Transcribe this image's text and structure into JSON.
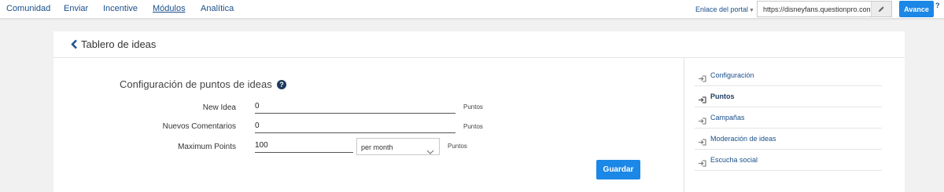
{
  "nav": {
    "items": [
      "Comunidad",
      "Enviar",
      "Incentive",
      "Módulos",
      "Analítica"
    ],
    "active_index": 3
  },
  "portal": {
    "label": "Enlace del portal",
    "url": "https://disneyfans.questionpro.com"
  },
  "advance_button": "Avance",
  "help_symbol": "?",
  "page": {
    "title": "Tablero de ideas",
    "section_title": "Configuración de puntos de ideas"
  },
  "form": {
    "rows": [
      {
        "label": "New Idea",
        "value": "0",
        "unit": "Puntos"
      },
      {
        "label": "Nuevos Comentarios",
        "value": "0",
        "unit": "Puntos"
      },
      {
        "label": "Maximum Points",
        "value": "100",
        "unit": "Puntos"
      }
    ],
    "period_select": "per month",
    "save_label": "Guardar"
  },
  "sidebar": {
    "items": [
      {
        "label": "Configuración",
        "active": false
      },
      {
        "label": "Puntos",
        "active": true
      },
      {
        "label": "Campañas",
        "active": false
      },
      {
        "label": "Moderación de ideas",
        "active": false
      },
      {
        "label": "Escucha social",
        "active": false
      }
    ]
  },
  "colors": {
    "accent": "#1b87e6",
    "link": "#1a4f8a"
  }
}
